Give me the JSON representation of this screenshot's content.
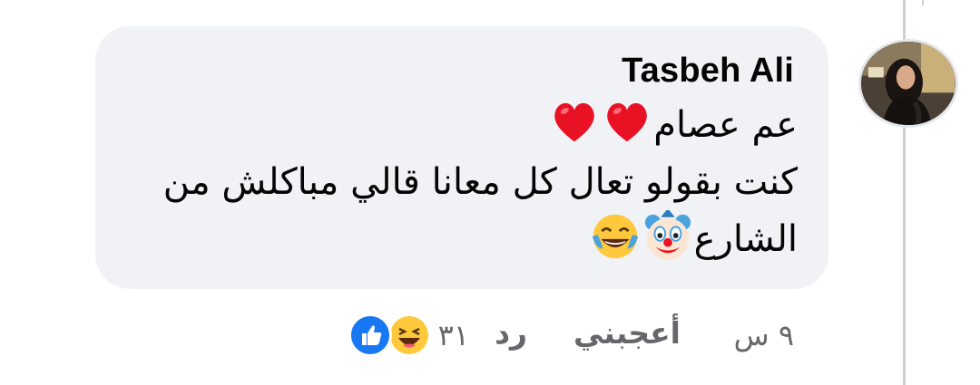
{
  "comment": {
    "author": "Tasbeh Ali",
    "lines": [
      "عم عصام",
      "كنت بقولو تعال كل معانا قالي مباكلش من",
      "الشارع"
    ],
    "line_emojis": [
      [
        "red-heart",
        "red-heart"
      ],
      [],
      [
        "clown-face",
        "face-with-tears-of-joy"
      ]
    ],
    "timestamp": "٩ س",
    "like_label": "أعجبني",
    "reply_label": "رد",
    "reaction_count": "٣١",
    "reactions": [
      "like",
      "haha"
    ]
  },
  "colors": {
    "bubble": "#f0f2f5",
    "text": "#050505",
    "secondary_text": "#65676b",
    "like_blue": "#1877f2",
    "heart_red": "#e81224",
    "emoji_yellow": "#ffc83d"
  }
}
